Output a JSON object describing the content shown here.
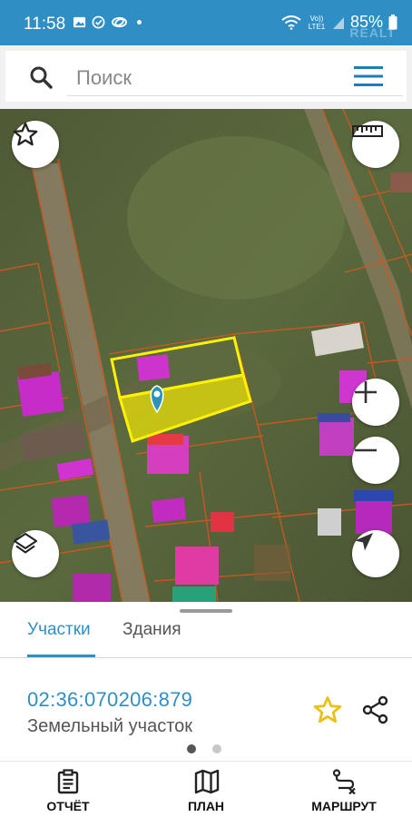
{
  "status_bar": {
    "time": "11:58",
    "battery": "85%",
    "network": "Vo)) LTE1",
    "watermark": "REALT"
  },
  "search": {
    "placeholder": "Поиск"
  },
  "map_controls": {
    "favorite_icon": "star-outline-icon",
    "ruler_icon": "ruler-icon",
    "zoom_in_icon": "plus-icon",
    "zoom_out_icon": "minus-icon",
    "layers_icon": "layers-icon",
    "location_icon": "navigation-arrow-icon"
  },
  "tabs": [
    {
      "label": "Участки",
      "active": true
    },
    {
      "label": "Здания",
      "active": false
    }
  ],
  "parcel": {
    "cadastral_number": "02:36:070206:879",
    "type": "Земельный участок"
  },
  "pager": {
    "pages": 2,
    "current": 1
  },
  "bottom_nav": [
    {
      "label": "ОТЧЁТ",
      "icon": "report-icon"
    },
    {
      "label": "ПЛАН",
      "icon": "map-plan-icon"
    },
    {
      "label": "МАРШРУТ",
      "icon": "route-icon"
    }
  ],
  "colors": {
    "accent": "#2f8fc5",
    "highlight": "#fff200",
    "star": "#e8c21a"
  }
}
